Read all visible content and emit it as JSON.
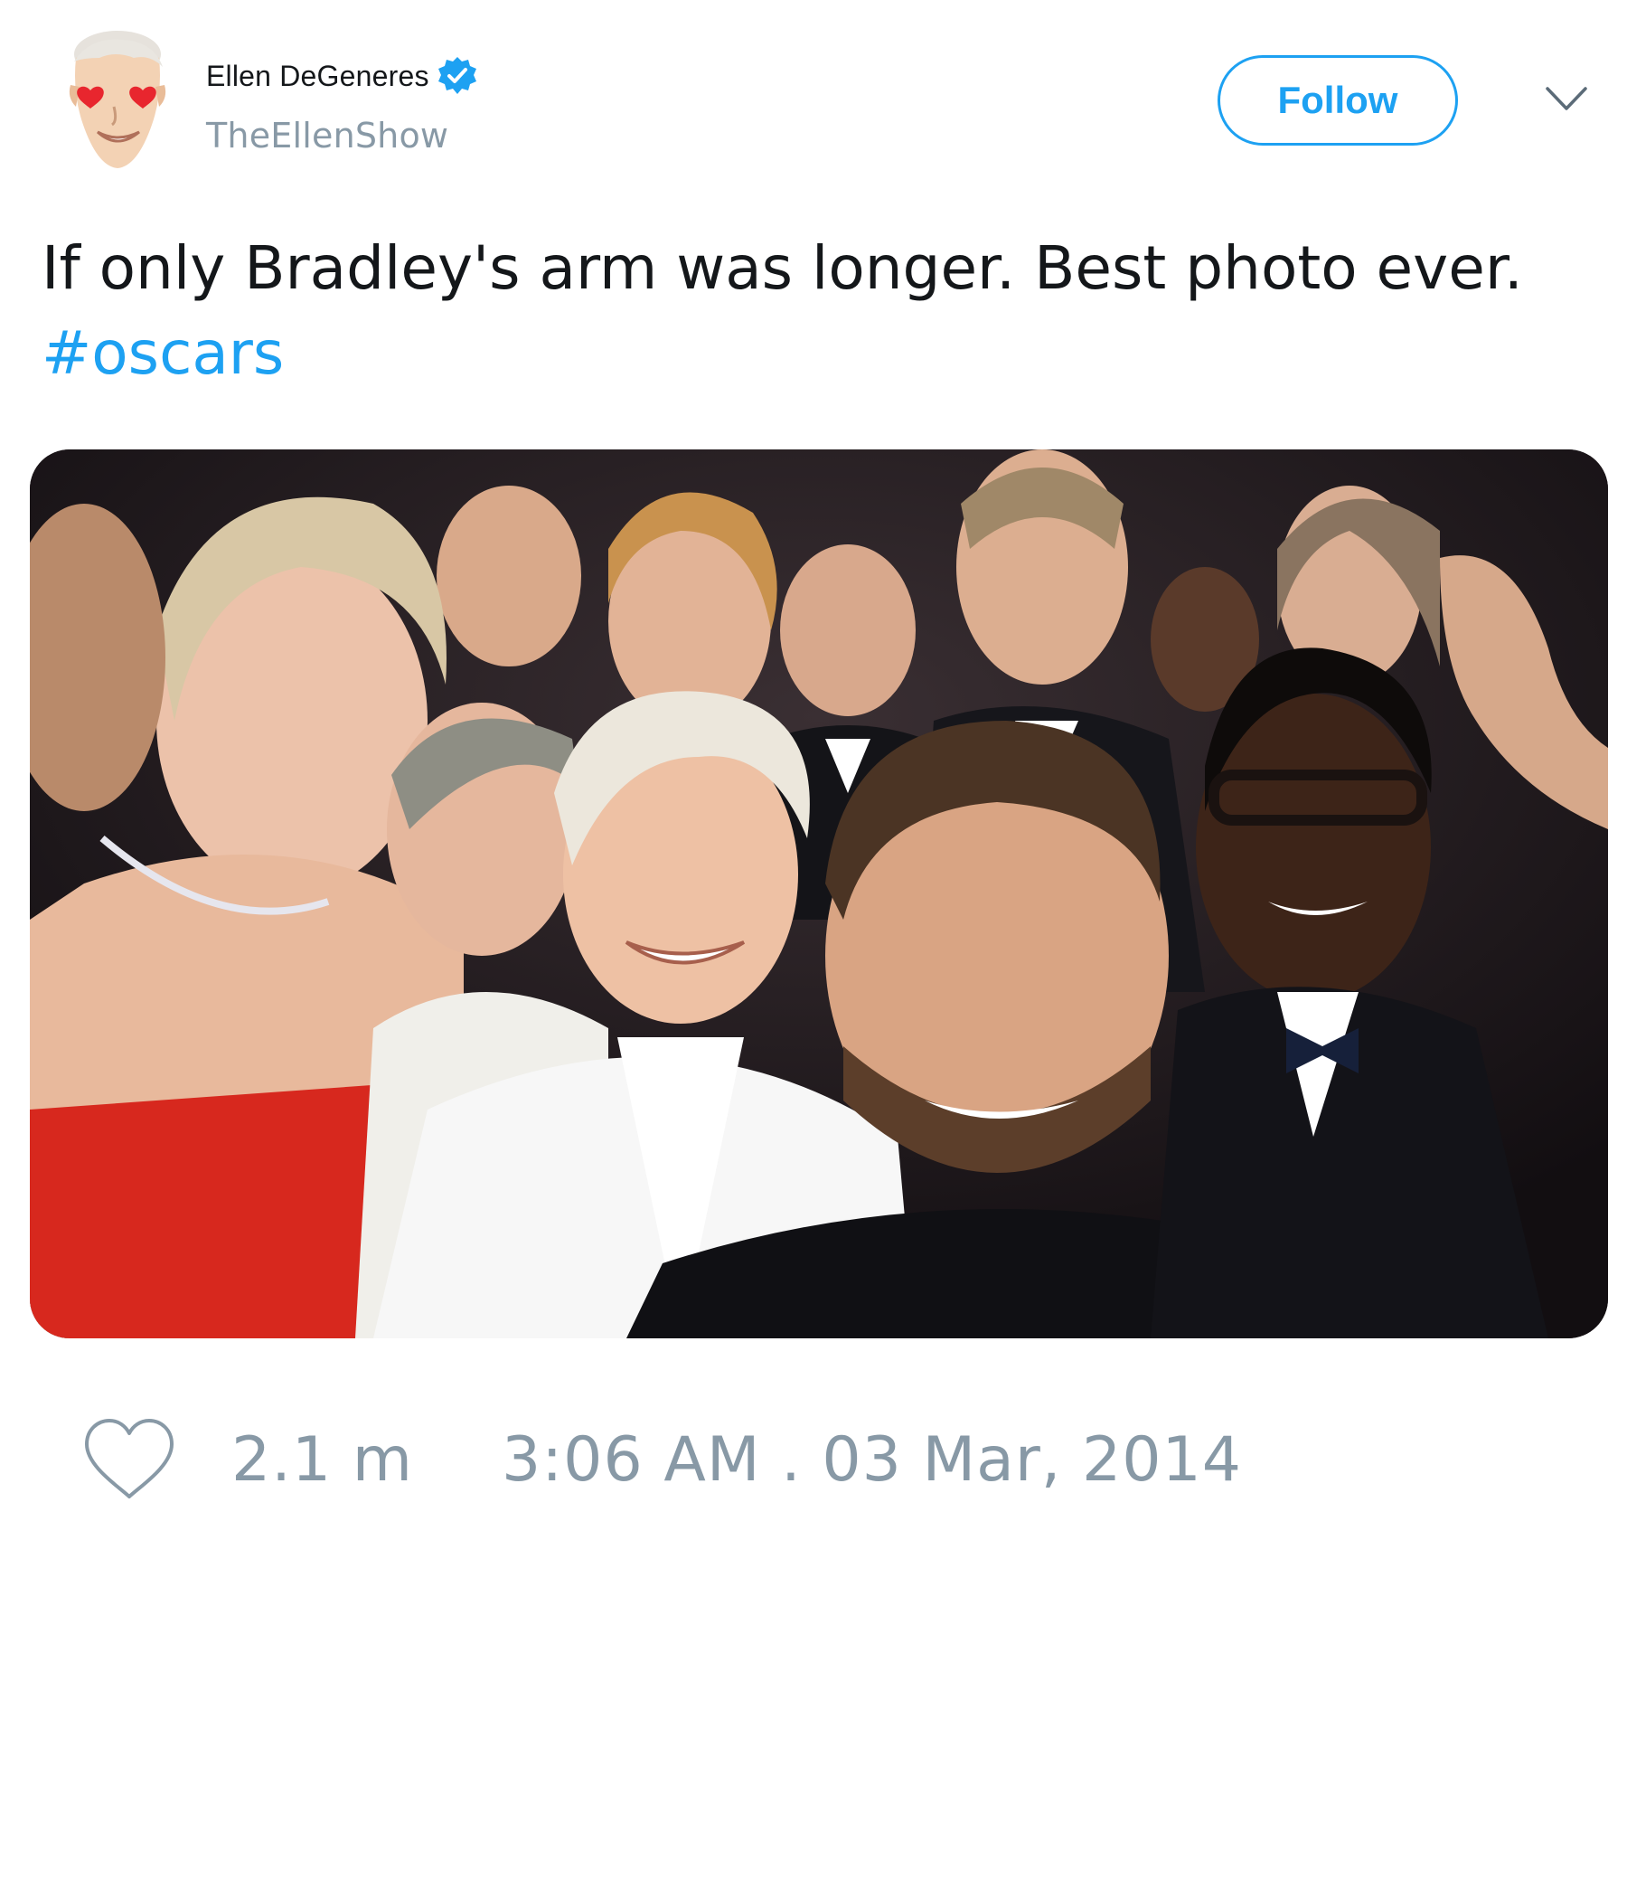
{
  "author": {
    "display_name": "Ellen DeGeneres",
    "handle": "TheEllenShow",
    "verified": true,
    "avatar_icon": "cartoon-face-heart-eyes-icon"
  },
  "header": {
    "follow_label": "Follow",
    "menu_icon": "chevron-down-icon"
  },
  "tweet": {
    "text": "If only Bradley's arm was longer. Best photo ever.",
    "hashtag": "#oscars",
    "media_description_icon": "group-selfie-photo"
  },
  "footer": {
    "like_icon": "heart-outline-icon",
    "like_count": "2.1 m",
    "timestamp": "3:06 AM . 03 Mar, 2014"
  },
  "colors": {
    "accent": "#1da1f2",
    "text": "#14171a",
    "muted": "#8899a6",
    "background": "#ffffff"
  }
}
